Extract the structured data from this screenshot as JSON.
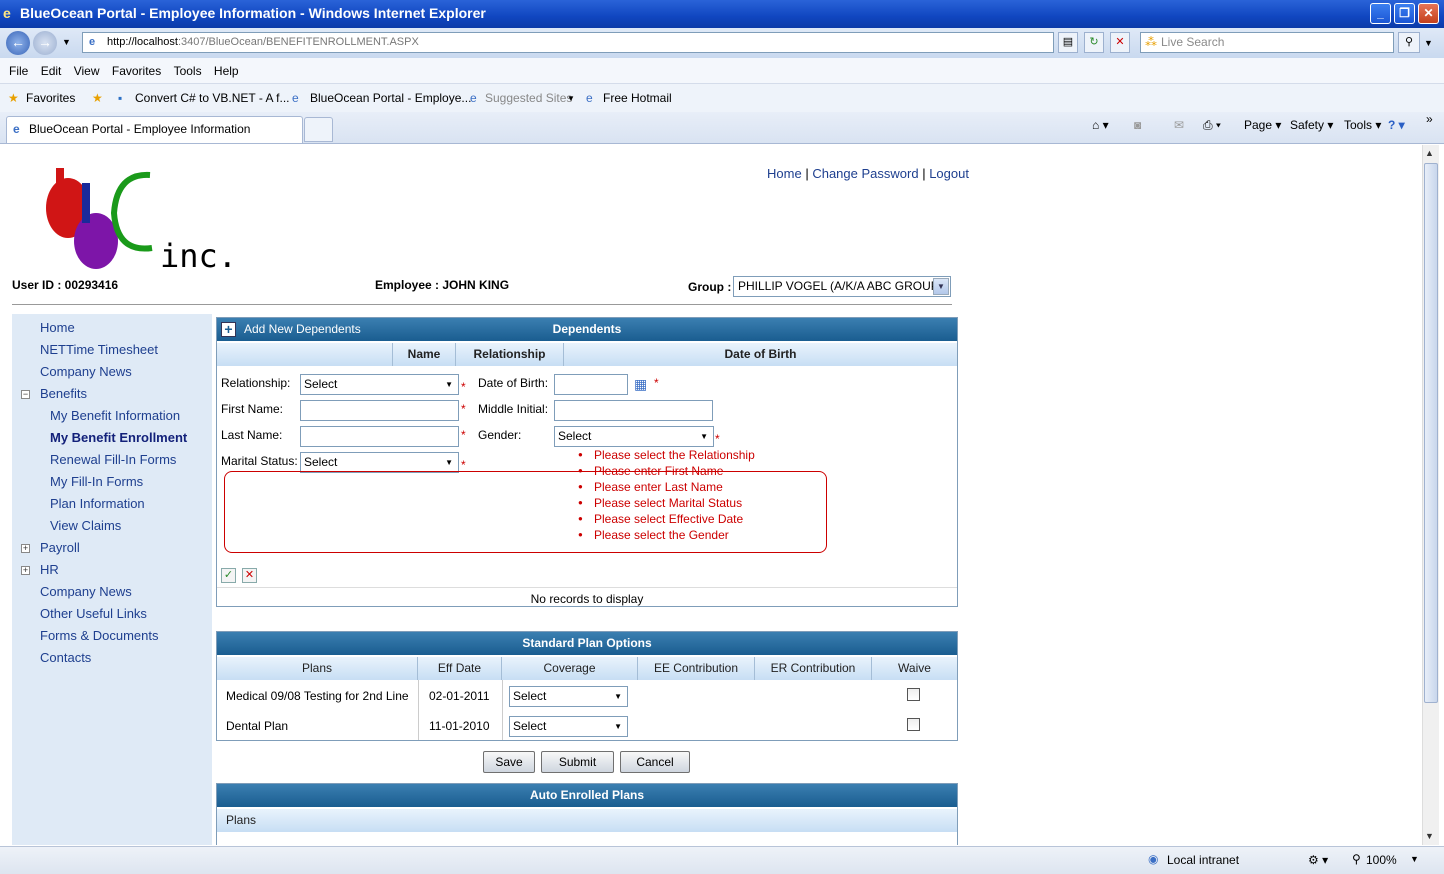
{
  "window": {
    "title": "BlueOcean Portal - Employee Information - Windows Internet Explorer"
  },
  "browser": {
    "url_host": "http://localhost",
    "url_rest": ":3407/BlueOcean/BENEFITENROLLMENT.ASPX",
    "search_placeholder": "Live Search",
    "menu": [
      "File",
      "Edit",
      "View",
      "Favorites",
      "Tools",
      "Help"
    ],
    "favorites_label": "Favorites",
    "fav_links": [
      "Convert C# to VB.NET - A f...",
      "BlueOcean Portal - Employe...",
      "Suggested Sites",
      "Free Hotmail"
    ],
    "tab_label": "BlueOcean Portal - Employee Information",
    "commands": [
      "Page",
      "Safety",
      "Tools"
    ],
    "status_zone": "Local intranet",
    "zoom": "100%"
  },
  "header": {
    "logo_text": "inc.",
    "links": [
      "Home",
      "Change Password",
      "Logout"
    ],
    "user_id": "User ID : 00293416",
    "employee": "Employee : JOHN KING",
    "group_label": "Group :",
    "group_value": "PHILLIP VOGEL (A/K/A ABC GROUP)"
  },
  "sidebar": {
    "items": [
      "Home",
      "NETTime Timesheet",
      "Company News",
      "Benefits",
      "My Benefit Information",
      "My Benefit Enrollment",
      "Renewal Fill-In Forms",
      "My Fill-In Forms",
      "Plan Information",
      "View Claims",
      "Payroll",
      "HR",
      "Company News",
      "Other Useful Links",
      "Forms & Documents",
      "Contacts"
    ]
  },
  "dependents": {
    "add_label": "Add New Dependents",
    "title": "Dependents",
    "columns": [
      "Name",
      "Relationship",
      "Date of Birth"
    ],
    "form": {
      "relationship_label": "Relationship:",
      "relationship_value": "Select",
      "dob_label": "Date of Birth:",
      "first_name_label": "First Name:",
      "middle_initial_label": "Middle Initial:",
      "last_name_label": "Last Name:",
      "gender_label": "Gender:",
      "gender_value": "Select",
      "marital_label": "Marital Status:",
      "marital_value": "Select",
      "required_mark": "*"
    },
    "errors": [
      "Please select the Relationship",
      "Please enter First Name",
      "Please enter Last Name",
      "Please select Marital Status",
      "Please select Effective Date",
      "Please select the Gender"
    ],
    "empty_text": "No records to display"
  },
  "standard_plans": {
    "title": "Standard Plan Options",
    "columns": [
      "Plans",
      "Eff Date",
      "Coverage",
      "EE Contribution",
      "ER Contribution",
      "Waive"
    ],
    "rows": [
      {
        "plan": "Medical 09/08 Testing for 2nd Line",
        "eff_date": "02-01-2011",
        "coverage": "Select"
      },
      {
        "plan": "Dental Plan",
        "eff_date": "11-01-2010",
        "coverage": "Select"
      }
    ]
  },
  "actions": {
    "save": "Save",
    "submit": "Submit",
    "cancel": "Cancel"
  },
  "auto_enrolled": {
    "title": "Auto Enrolled Plans",
    "column": "Plans"
  }
}
